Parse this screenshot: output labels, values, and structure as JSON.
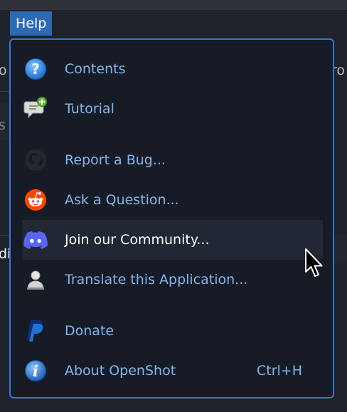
{
  "menubar": {
    "help_label": "Help"
  },
  "background": {
    "partial_left_1": "o",
    "partial_right_1": "ro",
    "partial_left_2": "s",
    "partial_left_3": "di"
  },
  "menu": {
    "items": [
      {
        "label": "Contents",
        "icon": "help-circle-icon"
      },
      {
        "label": "Tutorial",
        "icon": "chat-bubble-plus-icon"
      },
      {
        "label": "Report a Bug...",
        "icon": "github-icon"
      },
      {
        "label": "Ask a Question...",
        "icon": "reddit-icon"
      },
      {
        "label": "Join our Community...",
        "icon": "discord-icon",
        "highlighted": true
      },
      {
        "label": "Translate this Application...",
        "icon": "person-icon"
      },
      {
        "label": "Donate",
        "icon": "paypal-icon"
      },
      {
        "label": "About OpenShot",
        "icon": "info-circle-icon",
        "shortcut": "Ctrl+H"
      }
    ]
  },
  "colors": {
    "accent": "#2f7ad6",
    "menu_bg": "#171b25",
    "item_text": "#7fb6ec",
    "highlight_bg": "#212733"
  }
}
